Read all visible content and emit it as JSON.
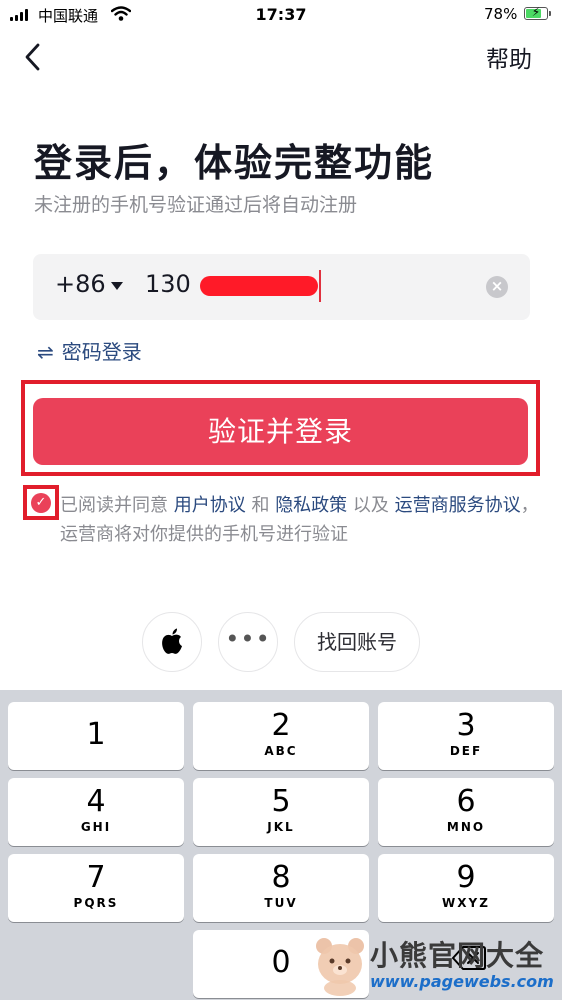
{
  "status_bar": {
    "carrier": "中国联通",
    "time": "17:37",
    "battery_percent": "78%",
    "battery_level": 0.78,
    "signal_icon": "signal-bars-icon",
    "wifi_icon": "wifi-icon",
    "battery_icon": "battery-charging-icon"
  },
  "nav": {
    "back_icon": "chevron-left-icon",
    "help_label": "帮助"
  },
  "header": {
    "title": "登录后，体验完整功能",
    "subtitle": "未注册的手机号验证通过后将自动注册"
  },
  "phone_input": {
    "country_code": "+86",
    "value_visible": "130",
    "value_redacted": true,
    "clear_icon": "clear-circle-icon"
  },
  "password_login": {
    "icon": "swap-arrows-icon",
    "label": "密码登录"
  },
  "login_button": {
    "label": "验证并登录",
    "color": "#ea4159"
  },
  "agreement": {
    "checked": true,
    "text_1": "已阅读并同意 ",
    "link_user": "用户协议",
    "text_2": " 和 ",
    "link_privacy": "隐私政策",
    "text_3": " 以及 ",
    "link_carrier": "运营商服务协议",
    "text_4": "，运营商将对你提供的手机号进行验证"
  },
  "third_party": {
    "apple_icon": "apple-logo-icon",
    "more_label": "•••",
    "recover_label": "找回账号"
  },
  "keypad": {
    "keys": [
      {
        "num": "1",
        "letters": ""
      },
      {
        "num": "2",
        "letters": "ABC"
      },
      {
        "num": "3",
        "letters": "DEF"
      },
      {
        "num": "4",
        "letters": "GHI"
      },
      {
        "num": "5",
        "letters": "JKL"
      },
      {
        "num": "6",
        "letters": "MNO"
      },
      {
        "num": "7",
        "letters": "PQRS"
      },
      {
        "num": "8",
        "letters": "TUV"
      },
      {
        "num": "9",
        "letters": "WXYZ"
      },
      {
        "num": "0",
        "letters": ""
      }
    ],
    "delete_icon": "backspace-icon"
  },
  "watermark": {
    "title": "小熊官网大全",
    "url": "www.pagewebs.com",
    "logo_icon": "bear-logo-icon"
  },
  "colors": {
    "accent": "#ea4159",
    "link": "#2b4a7f",
    "highlight_box": "#e11d2b"
  }
}
